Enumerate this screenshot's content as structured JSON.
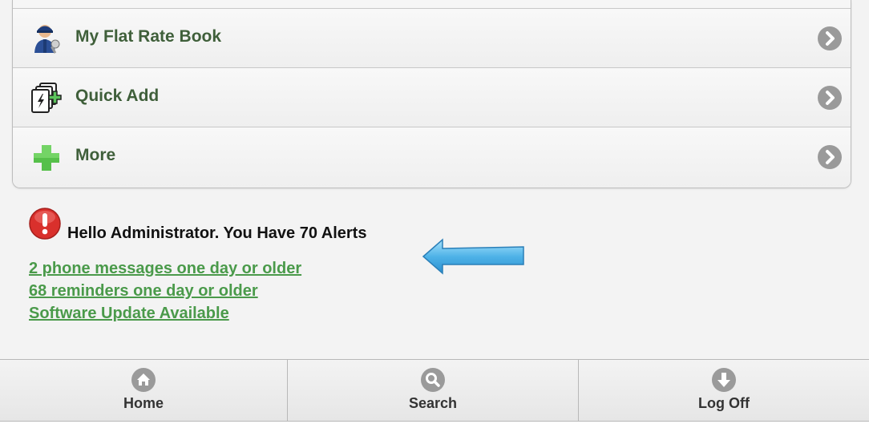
{
  "menu": {
    "items": [
      {
        "label": "My Flat Rate Book",
        "icon": "mechanic-icon"
      },
      {
        "label": "Quick Add",
        "icon": "quick-add-icon"
      },
      {
        "label": "More",
        "icon": "plus-icon"
      }
    ]
  },
  "alerts": {
    "title": "Hello Administrator. You Have 70 Alerts",
    "links": [
      "2 phone messages one day or older",
      "68 reminders one day or older",
      "Software Update Available"
    ]
  },
  "footer": {
    "home_label": "Home",
    "search_label": "Search",
    "logoff_label": "Log Off"
  },
  "colors": {
    "menu_label": "#3f5f3a",
    "link": "#4a9a4a",
    "alert_red": "#d9302c",
    "arrow_blue": "#4fb3e8",
    "icon_gray": "#9a9a9a"
  }
}
